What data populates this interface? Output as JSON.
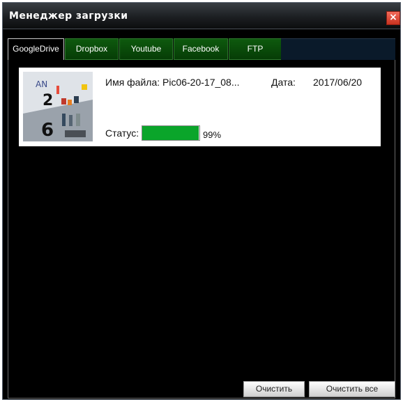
{
  "window": {
    "title": "Менеджер загрузки",
    "close_symbol": "×"
  },
  "tabs": [
    {
      "label": "GoogleDrive",
      "active": true
    },
    {
      "label": "Dropbox",
      "active": false
    },
    {
      "label": "Youtube",
      "active": false
    },
    {
      "label": "Facebook",
      "active": false
    },
    {
      "label": "FTP",
      "active": false
    }
  ],
  "upload_item": {
    "file_name_label": "Имя файла:",
    "file_name_value": "Pic06-20-17_08...",
    "date_label": "Дата:",
    "date_value": "2017/06/20",
    "status_label": "Статус:",
    "progress_percent_text": "99%",
    "progress_fraction": 0.99,
    "thumbnail_icon": "photo-thumbnail"
  },
  "buttons": {
    "clear": "Очистить",
    "clear_all": "Очистить все"
  },
  "colors": {
    "progress": "#0aa52a",
    "tab_inactive": "#0b4f0b",
    "close": "#d9412e"
  }
}
